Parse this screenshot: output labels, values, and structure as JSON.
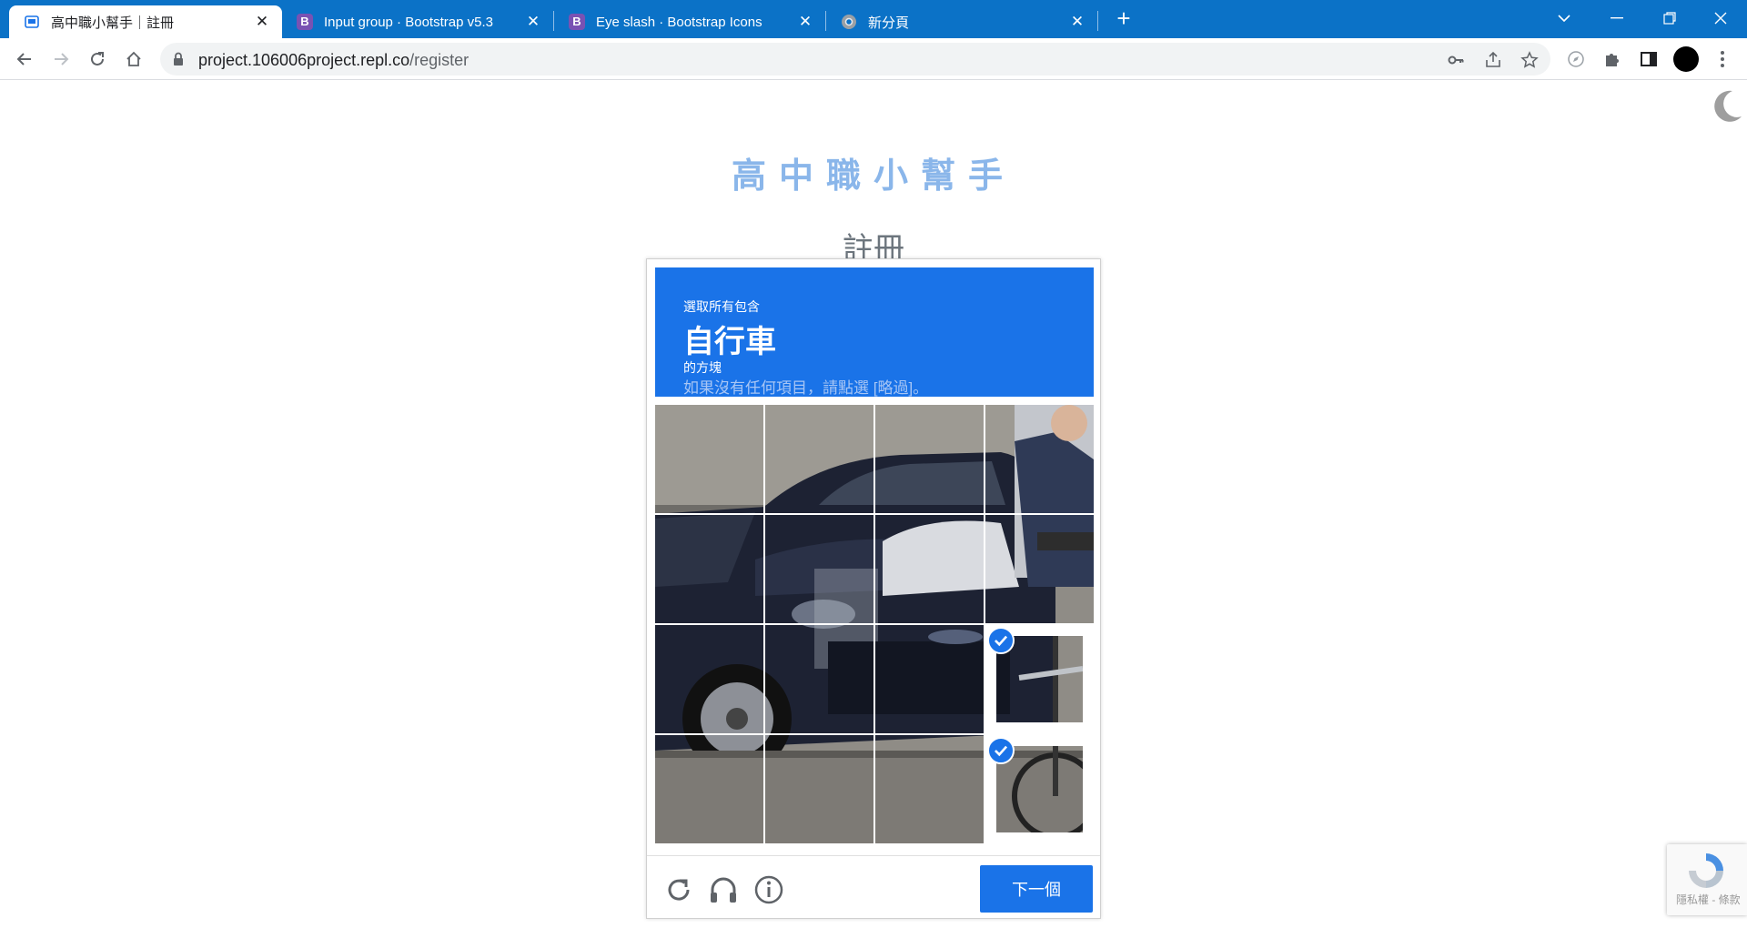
{
  "browser": {
    "tabs": [
      {
        "title": "高中職小幫手｜註冊",
        "active": true,
        "favicon": "page-icon"
      },
      {
        "title": "Input group · Bootstrap v5.3",
        "active": false,
        "favicon": "bootstrap-icon"
      },
      {
        "title": "Eye slash · Bootstrap Icons",
        "active": false,
        "favicon": "bootstrap-icon"
      },
      {
        "title": "新分頁",
        "active": false,
        "favicon": "chrome-icon"
      }
    ],
    "url_host": "project.106006project.repl.co",
    "url_path": "/register",
    "accent": "#0b72c7"
  },
  "page": {
    "site_title": "高中職小幫手",
    "heading": "註冊",
    "title_color": "#8ab6ea"
  },
  "captcha": {
    "instruction_pre": "選取所有包含",
    "target": "自行車",
    "instruction_post": "的方塊",
    "hint": "如果沒有任何項目，請點選 [略過]。",
    "next_label": "下一個",
    "selected_tiles": [
      11,
      15
    ],
    "accent": "#1a73e8"
  },
  "badge": {
    "text": "隱私權 - 條款"
  }
}
